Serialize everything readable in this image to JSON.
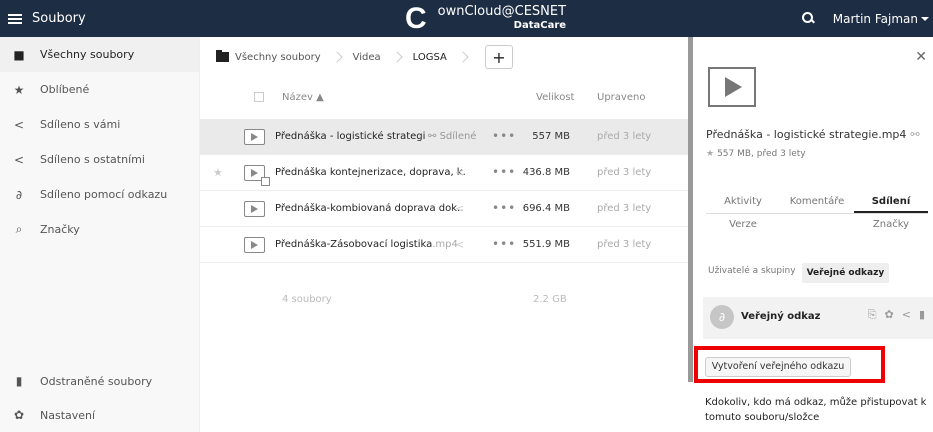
{
  "header": {
    "app_name": "Soubory",
    "brand_logo": "C",
    "brand_name": "ownCloud@CESNET",
    "brand_sub": "DataCare",
    "user_name": "Martin Fajman",
    "bg_color": "#1d2d44"
  },
  "sidebar": {
    "items": [
      {
        "icon": "folder-icon",
        "label": "Všechny soubory"
      },
      {
        "icon": "star-icon",
        "label": "Oblíbené"
      },
      {
        "icon": "share-icon",
        "label": "Sdíleno s vámi"
      },
      {
        "icon": "share-icon",
        "label": "Sdíleno s ostatními"
      },
      {
        "icon": "link-icon",
        "label": "Sdíleno pomocí odkazu"
      },
      {
        "icon": "tag-icon",
        "label": "Značky"
      }
    ],
    "bottom": [
      {
        "icon": "trash-icon",
        "label": "Odstraněné soubory"
      },
      {
        "icon": "gear-icon",
        "label": "Nastavení"
      }
    ]
  },
  "breadcrumb": {
    "items": [
      "Všechny soubory",
      "Videa",
      "LOGSA"
    ],
    "add_label": "+"
  },
  "table": {
    "columns": {
      "name": "Název ▲",
      "size": "Velikost",
      "modified": "Upraveno"
    },
    "rows": [
      {
        "name": "Přednáška - logistické strategi",
        "ext": "",
        "share_label": "Sdílené",
        "size": "557 MB",
        "modified": "před 3 lety"
      },
      {
        "name": "Přednáška kontejnerizace, doprava, k.",
        "ext": "",
        "share_label": "",
        "size": "436.8 MB",
        "modified": "před 3 lety"
      },
      {
        "name": "Přednáška-kombiovaná doprava dok..",
        "ext": "",
        "share_label": "",
        "size": "696.4 MB",
        "modified": "před 3 lety"
      },
      {
        "name": "Přednáška-Zásobovací logistika",
        "ext": ".mp4",
        "share_label": "",
        "size": "551.9 MB",
        "modified": "před 3 lety"
      }
    ],
    "summary": {
      "count": "4 soubory",
      "total": "2.2 GB"
    }
  },
  "details": {
    "filename": "Přednáška - logistické strategie.mp4",
    "meta": "557 MB, před 3 lety",
    "tabs_row1": [
      "Aktivity",
      "Komentáře",
      "Sdílení"
    ],
    "tabs_row2": [
      "Verze",
      "Značky"
    ],
    "share_tabs": [
      "Uživatelé a skupiny",
      "Veřejné odkazy"
    ],
    "public_link_label": "Veřejný odkaz",
    "create_button": "Vytvoření veřejného odkazu",
    "note": "Kdokoliv, kdo má odkaz, může přistupovat k tomuto souboru/složce"
  }
}
